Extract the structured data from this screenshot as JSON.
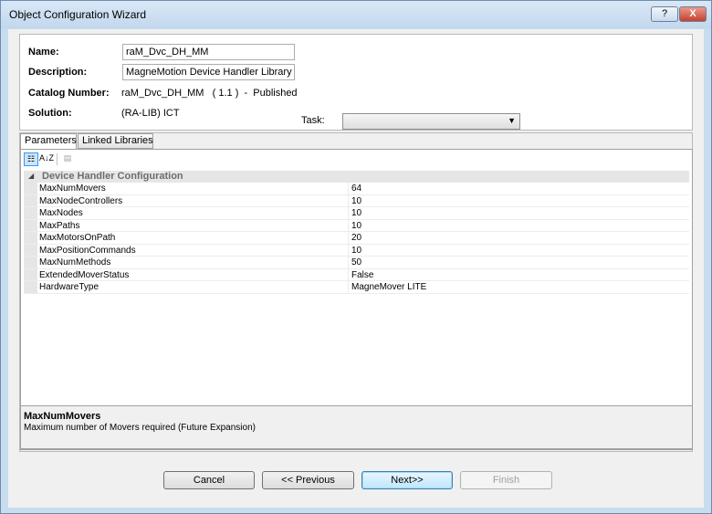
{
  "window": {
    "title": "Object Configuration Wizard",
    "help_label": "?",
    "close_label": "X"
  },
  "header": {
    "name_label": "Name:",
    "name_value": "raM_Dvc_DH_MM",
    "description_label": "Description:",
    "description_value": "MagneMotion Device Handler Library Obj",
    "catalog_label": "Catalog Number:",
    "catalog_value": "raM_Dvc_DH_MM   ( 1.1 )  -  Published",
    "solution_label": "Solution:",
    "solution_value": "(RA-LIB) ICT",
    "task_label": "Task:",
    "task_value": ""
  },
  "tabs": [
    {
      "label": "Parameters",
      "active": true
    },
    {
      "label": "Linked Libraries",
      "active": false
    }
  ],
  "toolbar": {
    "categorized_icon": "categorized-icon",
    "sort_icon": "alphabetical-sort-icon",
    "sort_label": "A↓Z",
    "pages_icon": "property-pages-icon"
  },
  "grid": {
    "category": "Device Handler Configuration",
    "rows": [
      {
        "name": "MaxNumMovers",
        "value": "64"
      },
      {
        "name": "MaxNodeControllers",
        "value": "10"
      },
      {
        "name": "MaxNodes",
        "value": "10"
      },
      {
        "name": "MaxPaths",
        "value": "10"
      },
      {
        "name": "MaxMotorsOnPath",
        "value": "20"
      },
      {
        "name": "MaxPositionCommands",
        "value": "10"
      },
      {
        "name": "MaxNumMethods",
        "value": "50"
      },
      {
        "name": "ExtendedMoverStatus",
        "value": "False"
      },
      {
        "name": "HardwareType",
        "value": "MagneMover LITE"
      }
    ]
  },
  "description_panel": {
    "title": "MaxNumMovers",
    "text": "Maximum number of Movers required (Future Expansion)"
  },
  "buttons": {
    "cancel": "Cancel",
    "previous": "<< Previous",
    "next": "Next>>",
    "finish": "Finish"
  }
}
